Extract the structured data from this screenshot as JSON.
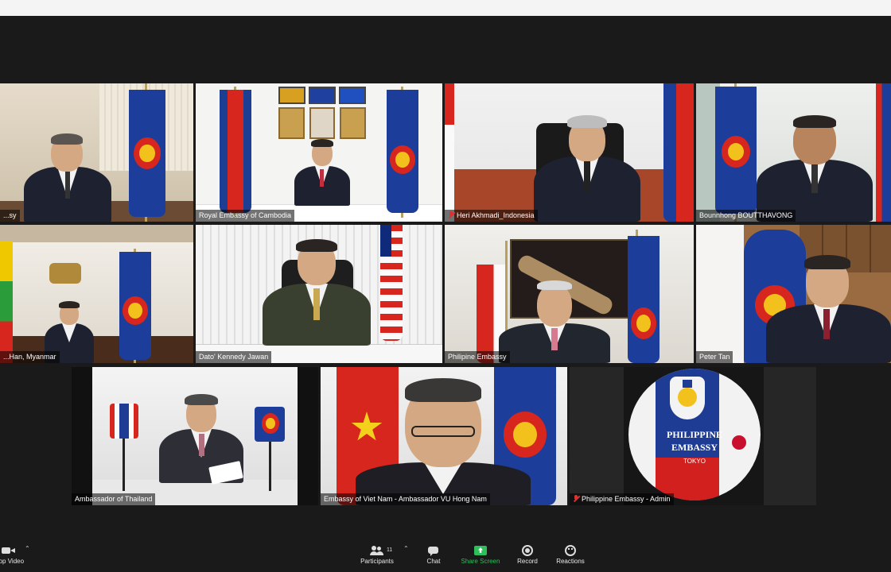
{
  "participants": [
    {
      "name": "...sy",
      "muted": false
    },
    {
      "name": "Royal Embassy of Cambodia",
      "muted": false
    },
    {
      "name": "Heri Akhmadi_Indonesia",
      "muted": true
    },
    {
      "name": "Bounnhong BOUTTHAVONG",
      "muted": false
    },
    {
      "name": "...Han, Myanmar",
      "muted": false
    },
    {
      "name": "Dato' Kennedy Jawan",
      "muted": false
    },
    {
      "name": "Philipine Embassy",
      "muted": false,
      "active_speaker": true
    },
    {
      "name": "Peter Tan",
      "muted": false
    },
    {
      "name": "Ambassador of Thailand",
      "muted": false
    },
    {
      "name": "Embassy of Viet Nam - Ambassador VU Hong Nam",
      "muted": false
    },
    {
      "name": "Philippine Embassy - Admin",
      "muted": true
    }
  ],
  "logo": {
    "line1": "PHILIPPINE",
    "line2": "EMBASSY",
    "line3": "TOKYO"
  },
  "toolbar": {
    "video_label": "...op Video",
    "participants_label": "Participants",
    "participants_count": "11",
    "chat_label": "Chat",
    "share_label": "Share Screen",
    "record_label": "Record",
    "reactions_label": "Reactions"
  },
  "colors": {
    "background": "#1a1a1a",
    "active_border": "#d8e860",
    "share_green": "#2fbf5a",
    "muted_red": "#e03030"
  }
}
